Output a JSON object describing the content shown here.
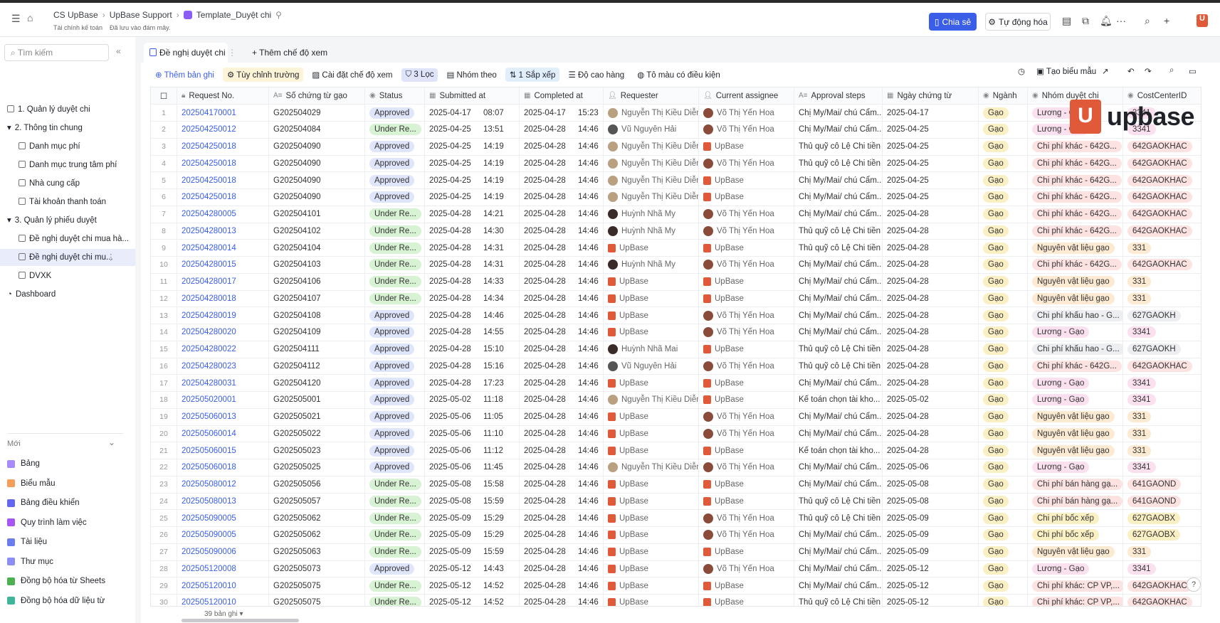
{
  "header": {
    "breadcrumb": [
      "CS UpBase",
      "UpBase Support",
      "Template_Duyệt chi"
    ],
    "workspace": "Tài chính kế toán",
    "save_status": "Đã lưu vào đám mây.",
    "share_label": "Chia sẻ",
    "automation_label": "Tự động hóa",
    "logo_text": "upbase"
  },
  "sidebar": {
    "search_placeholder": "Tìm kiếm",
    "items": [
      {
        "label": "1. Quản lý duyệt chi",
        "level": 0
      },
      {
        "label": "2. Thông tin chung",
        "level": 0,
        "expanded": true
      },
      {
        "label": "Danh mục phí",
        "level": 1
      },
      {
        "label": "Danh mục trung tâm phí",
        "level": 1
      },
      {
        "label": "Nhà cung cấp",
        "level": 1
      },
      {
        "label": "Tài khoản thanh toán",
        "level": 1
      },
      {
        "label": "3. Quản lý phiếu duyệt",
        "level": 0,
        "expanded": true
      },
      {
        "label": "Đề nghị duyệt chi mua hà...",
        "level": 1
      },
      {
        "label": "Đề nghị duyệt chi mu...",
        "level": 1,
        "active": true
      },
      {
        "label": "DVXK",
        "level": 1
      },
      {
        "label": "Dashboard",
        "level": 0
      }
    ],
    "new_label": "Mới",
    "new_items": [
      {
        "label": "Bảng",
        "color": "#a78bfa"
      },
      {
        "label": "Biểu mẫu",
        "color": "#f59e5b"
      },
      {
        "label": "Bảng điều khiển",
        "color": "#6366f1"
      },
      {
        "label": "Quy trình làm việc",
        "color": "#a855f7"
      },
      {
        "label": "Tài liệu",
        "color": "#6b7cf0"
      },
      {
        "label": "Thư mục",
        "color": "#8b8ef5"
      },
      {
        "label": "Đồng bộ hóa từ Sheets",
        "color": "#4caf50"
      },
      {
        "label": "Đồng bộ hóa dữ liệu từ",
        "color": "#3fb59a"
      }
    ]
  },
  "tabs": {
    "active": "Đề nghị duyệt chi",
    "add_view": "Thêm chế độ xem"
  },
  "toolbar": {
    "add_record": "Thêm bản ghi",
    "customize_fields": "Tùy chỉnh trường",
    "view_settings": "Cài đặt chế độ xem",
    "filter": "3 Lọc",
    "group": "Nhóm theo",
    "sort": "1 Sắp xếp",
    "row_height": "Độ cao hàng",
    "conditional_color": "Tô màu có điều kiện",
    "create_form": "Tạo biểu mẫu"
  },
  "columns": [
    "Request No.",
    "Số chứng từ gạo",
    "Status",
    "Submitted at",
    "Completed at",
    "Requester",
    "Current assignee",
    "Approval steps",
    "Ngày chứng từ",
    "Ngành",
    "Nhóm duyệt chi",
    "CostCenterID"
  ],
  "tag_colors": {
    "Lương - Gạo": "#fbe1ef",
    "Chi phí khác - 642G...": "#fde2e2",
    "Nguyên vật liệu gạo": "#fdead2",
    "Chi phí khấu hao - G...": "#eceef1",
    "Chi phí bán hàng gạ...": "#fde2e2",
    "Chi phí bốc xếp": "#fbefc4",
    "Chi phí khác: CP VP,...": "#fde2e2"
  },
  "rows": [
    {
      "n": "1",
      "id": "202504170001",
      "g": "G202504029",
      "s": "Approved",
      "sd": "2025-04-17",
      "st": "08:07",
      "cd": "2025-04-17",
      "ct": "15:23",
      "req": "Nguyễn Thị Kiều Diễm",
      "asg": "Võ Thị Yến Hoa",
      "step": "Chị My/Mai/ chú Cẩm...",
      "date": "2025-04-17",
      "ind": "Gạo",
      "grp": "Lương - Gạo",
      "cc": "3341"
    },
    {
      "n": "2",
      "id": "202504250012",
      "g": "G202504084",
      "s": "Under Re...",
      "sd": "2025-04-25",
      "st": "13:51",
      "cd": "2025-04-28",
      "ct": "14:46",
      "req": "Vũ Nguyên Hải",
      "asg": "Võ Thị Yến Hoa",
      "step": "Chị My/Mai/ chú Cẩm...",
      "date": "2025-04-25",
      "ind": "Gạo",
      "grp": "Lương - Gạo",
      "cc": "3341"
    },
    {
      "n": "3",
      "id": "202504250018",
      "g": "G202504090",
      "s": "Approved",
      "sd": "2025-04-25",
      "st": "14:19",
      "cd": "2025-04-28",
      "ct": "14:46",
      "req": "Nguyễn Thị Kiều Diễm",
      "asg": "UpBase",
      "step": "Thủ quỹ cô Lệ Chi tiền",
      "date": "2025-04-25",
      "ind": "Gạo",
      "grp": "Chi phí khác - 642G...",
      "cc": "642GAOKHAC"
    },
    {
      "n": "4",
      "id": "202504250018",
      "g": "G202504090",
      "s": "Approved",
      "sd": "2025-04-25",
      "st": "14:19",
      "cd": "2025-04-28",
      "ct": "14:46",
      "req": "Nguyễn Thị Kiều Diễm",
      "asg": "Võ Thị Yến Hoa",
      "step": "Thủ quỹ cô Lệ Chi tiền",
      "date": "2025-04-25",
      "ind": "Gạo",
      "grp": "Chi phí khác - 642G...",
      "cc": "642GAOKHAC"
    },
    {
      "n": "5",
      "id": "202504250018",
      "g": "G202504090",
      "s": "Approved",
      "sd": "2025-04-25",
      "st": "14:19",
      "cd": "2025-04-28",
      "ct": "14:46",
      "req": "Nguyễn Thị Kiều Diễm",
      "asg": "UpBase",
      "step": "Chị My/Mai/ chú Cẩm...",
      "date": "2025-04-25",
      "ind": "Gạo",
      "grp": "Chi phí khác - 642G...",
      "cc": "642GAOKHAC"
    },
    {
      "n": "6",
      "id": "202504250018",
      "g": "G202504090",
      "s": "Approved",
      "sd": "2025-04-25",
      "st": "14:19",
      "cd": "2025-04-28",
      "ct": "14:46",
      "req": "Nguyễn Thị Kiều Diễm",
      "asg": "UpBase",
      "step": "Chị My/Mai/ chú Cẩm...",
      "date": "2025-04-25",
      "ind": "Gạo",
      "grp": "Chi phí khác - 642G...",
      "cc": "642GAOKHAC"
    },
    {
      "n": "7",
      "id": "202504280005",
      "g": "G202504101",
      "s": "Under Re...",
      "sd": "2025-04-28",
      "st": "14:21",
      "cd": "2025-04-28",
      "ct": "14:46",
      "req": "Huỳnh Nhã My",
      "asg": "Võ Thị Yến Hoa",
      "step": "Chị My/Mai/ chú Cẩm...",
      "date": "2025-04-28",
      "ind": "Gạo",
      "grp": "Chi phí khác - 642G...",
      "cc": "642GAOKHAC"
    },
    {
      "n": "8",
      "id": "202504280013",
      "g": "G202504102",
      "s": "Under Re...",
      "sd": "2025-04-28",
      "st": "14:30",
      "cd": "2025-04-28",
      "ct": "14:46",
      "req": "Huỳnh Nhã My",
      "asg": "Võ Thị Yến Hoa",
      "step": "Thủ quỹ cô Lệ Chi tiền",
      "date": "2025-04-28",
      "ind": "Gạo",
      "grp": "Chi phí khác - 642G...",
      "cc": "642GAOKHAC"
    },
    {
      "n": "9",
      "id": "202504280014",
      "g": "G202504104",
      "s": "Under Re...",
      "sd": "2025-04-28",
      "st": "14:31",
      "cd": "2025-04-28",
      "ct": "14:46",
      "req": "UpBase",
      "asg": "UpBase",
      "step": "Thủ quỹ cô Lệ Chi tiền",
      "date": "2025-04-28",
      "ind": "Gạo",
      "grp": "Nguyên vật liệu gạo",
      "cc": "331"
    },
    {
      "n": "10",
      "id": "202504280015",
      "g": "G202504103",
      "s": "Under Re...",
      "sd": "2025-04-28",
      "st": "14:31",
      "cd": "2025-04-28",
      "ct": "14:46",
      "req": "Huỳnh Nhã My",
      "asg": "Võ Thị Yến Hoa",
      "step": "Chị My/Mai/ chú Cẩm...",
      "date": "2025-04-28",
      "ind": "Gạo",
      "grp": "Chi phí khác - 642G...",
      "cc": "642GAOKHAC"
    },
    {
      "n": "11",
      "id": "202504280017",
      "g": "G202504106",
      "s": "Under Re...",
      "sd": "2025-04-28",
      "st": "14:33",
      "cd": "2025-04-28",
      "ct": "14:46",
      "req": "UpBase",
      "asg": "UpBase",
      "step": "Chị My/Mai/ chú Cẩm...",
      "date": "2025-04-28",
      "ind": "Gạo",
      "grp": "Nguyên vật liệu gạo",
      "cc": "331"
    },
    {
      "n": "12",
      "id": "202504280018",
      "g": "G202504107",
      "s": "Under Re...",
      "sd": "2025-04-28",
      "st": "14:34",
      "cd": "2025-04-28",
      "ct": "14:46",
      "req": "UpBase",
      "asg": "UpBase",
      "step": "Chị My/Mai/ chú Cẩm...",
      "date": "2025-04-28",
      "ind": "Gạo",
      "grp": "Nguyên vật liệu gạo",
      "cc": "331"
    },
    {
      "n": "13",
      "id": "202504280019",
      "g": "G202504108",
      "s": "Approved",
      "sd": "2025-04-28",
      "st": "14:46",
      "cd": "2025-04-28",
      "ct": "14:46",
      "req": "UpBase",
      "asg": "Võ Thị Yến Hoa",
      "step": "Chị My/Mai/ chú Cẩm...",
      "date": "2025-04-28",
      "ind": "Gạo",
      "grp": "Chi phí khấu hao - G...",
      "cc": "627GAOKH"
    },
    {
      "n": "14",
      "id": "202504280020",
      "g": "G202504109",
      "s": "Approved",
      "sd": "2025-04-28",
      "st": "14:55",
      "cd": "2025-04-28",
      "ct": "14:46",
      "req": "UpBase",
      "asg": "Võ Thị Yến Hoa",
      "step": "Chị My/Mai/ chú Cẩm...",
      "date": "2025-04-28",
      "ind": "Gạo",
      "grp": "Lương - Gạo",
      "cc": "3341"
    },
    {
      "n": "15",
      "id": "202504280022",
      "g": "G202504111",
      "s": "Approved",
      "sd": "2025-04-28",
      "st": "15:10",
      "cd": "2025-04-28",
      "ct": "14:46",
      "req": "Huỳnh Nhã Mai",
      "asg": "UpBase",
      "step": "Thủ quỹ cô Lệ Chi tiền",
      "date": "2025-04-28",
      "ind": "Gạo",
      "grp": "Chi phí khấu hao - G...",
      "cc": "627GAOKH"
    },
    {
      "n": "16",
      "id": "202504280023",
      "g": "G202504112",
      "s": "Approved",
      "sd": "2025-04-28",
      "st": "15:16",
      "cd": "2025-04-28",
      "ct": "14:46",
      "req": "Vũ Nguyên Hải",
      "asg": "Võ Thị Yến Hoa",
      "step": "Thủ quỹ cô Lệ Chi tiền",
      "date": "2025-04-28",
      "ind": "Gạo",
      "grp": "Chi phí khác - 642G...",
      "cc": "642GAOKHAC"
    },
    {
      "n": "17",
      "id": "202504280031",
      "g": "G202504120",
      "s": "Approved",
      "sd": "2025-04-28",
      "st": "17:23",
      "cd": "2025-04-28",
      "ct": "14:46",
      "req": "UpBase",
      "asg": "UpBase",
      "step": "Chị My/Mai/ chú Cẩm...",
      "date": "2025-04-28",
      "ind": "Gạo",
      "grp": "Lương - Gạo",
      "cc": "3341"
    },
    {
      "n": "18",
      "id": "202505020001",
      "g": "G202505001",
      "s": "Approved",
      "sd": "2025-05-02",
      "st": "11:18",
      "cd": "2025-04-28",
      "ct": "14:46",
      "req": "Nguyễn Thị Kiều Diễm",
      "asg": "UpBase",
      "step": "Kế toán chọn tài kho...",
      "date": "2025-05-02",
      "ind": "Gạo",
      "grp": "Lương - Gạo",
      "cc": "3341"
    },
    {
      "n": "19",
      "id": "202505060013",
      "g": "G202505021",
      "s": "Approved",
      "sd": "2025-05-06",
      "st": "11:05",
      "cd": "2025-04-28",
      "ct": "14:46",
      "req": "UpBase",
      "asg": "Võ Thị Yến Hoa",
      "step": "Chị My/Mai/ chú Cẩm...",
      "date": "2025-04-28",
      "ind": "Gạo",
      "grp": "Nguyên vật liệu gạo",
      "cc": "331"
    },
    {
      "n": "20",
      "id": "202505060014",
      "g": "G202505022",
      "s": "Approved",
      "sd": "2025-05-06",
      "st": "11:10",
      "cd": "2025-04-28",
      "ct": "14:46",
      "req": "UpBase",
      "asg": "Võ Thị Yến Hoa",
      "step": "Chị My/Mai/ chú Cẩm...",
      "date": "2025-04-28",
      "ind": "Gạo",
      "grp": "Nguyên vật liệu gạo",
      "cc": "331"
    },
    {
      "n": "21",
      "id": "202505060015",
      "g": "G202505023",
      "s": "Approved",
      "sd": "2025-05-06",
      "st": "11:12",
      "cd": "2025-04-28",
      "ct": "14:46",
      "req": "UpBase",
      "asg": "UpBase",
      "step": "Kế toán chọn tài kho...",
      "date": "2025-04-28",
      "ind": "Gạo",
      "grp": "Nguyên vật liệu gạo",
      "cc": "331"
    },
    {
      "n": "22",
      "id": "202505060018",
      "g": "G202505025",
      "s": "Approved",
      "sd": "2025-05-06",
      "st": "11:45",
      "cd": "2025-04-28",
      "ct": "14:46",
      "req": "Nguyễn Thị Kiều Diễm",
      "asg": "Võ Thị Yến Hoa",
      "step": "Chị My/Mai/ chú Cẩm...",
      "date": "2025-05-06",
      "ind": "Gạo",
      "grp": "Lương - Gạo",
      "cc": "3341"
    },
    {
      "n": "23",
      "id": "202505080012",
      "g": "G202505056",
      "s": "Under Re...",
      "sd": "2025-05-08",
      "st": "15:58",
      "cd": "2025-04-28",
      "ct": "14:46",
      "req": "UpBase",
      "asg": "UpBase",
      "step": "Chị My/Mai/ chú Cẩm...",
      "date": "2025-05-08",
      "ind": "Gạo",
      "grp": "Chi phí bán hàng gạ...",
      "cc": "641GAOND"
    },
    {
      "n": "24",
      "id": "202505080013",
      "g": "G202505057",
      "s": "Under Re...",
      "sd": "2025-05-08",
      "st": "15:59",
      "cd": "2025-04-28",
      "ct": "14:46",
      "req": "UpBase",
      "asg": "UpBase",
      "step": "Thủ quỹ cô Lệ Chi tiền",
      "date": "2025-05-08",
      "ind": "Gạo",
      "grp": "Chi phí bán hàng gạ...",
      "cc": "641GAOND"
    },
    {
      "n": "25",
      "id": "202505090005",
      "g": "G202505062",
      "s": "Under Re...",
      "sd": "2025-05-09",
      "st": "15:29",
      "cd": "2025-04-28",
      "ct": "14:46",
      "req": "UpBase",
      "asg": "Võ Thị Yến Hoa",
      "step": "Thủ quỹ cô Lệ Chi tiền",
      "date": "2025-05-09",
      "ind": "Gạo",
      "grp": "Chi phí bốc xếp",
      "cc": "627GAOBX"
    },
    {
      "n": "26",
      "id": "202505090005",
      "g": "G202505062",
      "s": "Under Re...",
      "sd": "2025-05-09",
      "st": "15:29",
      "cd": "2025-04-28",
      "ct": "14:46",
      "req": "UpBase",
      "asg": "Võ Thị Yến Hoa",
      "step": "Chị My/Mai/ chú Cẩm...",
      "date": "2025-05-09",
      "ind": "Gạo",
      "grp": "Chi phí bốc xếp",
      "cc": "627GAOBX"
    },
    {
      "n": "27",
      "id": "202505090006",
      "g": "G202505063",
      "s": "Under Re...",
      "sd": "2025-05-09",
      "st": "15:59",
      "cd": "2025-04-28",
      "ct": "14:46",
      "req": "UpBase",
      "asg": "UpBase",
      "step": "Chị My/Mai/ chú Cẩm...",
      "date": "2025-05-09",
      "ind": "Gạo",
      "grp": "Nguyên vật liệu gạo",
      "cc": "331"
    },
    {
      "n": "28",
      "id": "202505120008",
      "g": "G202505073",
      "s": "Approved",
      "sd": "2025-05-12",
      "st": "14:43",
      "cd": "2025-04-28",
      "ct": "14:46",
      "req": "UpBase",
      "asg": "Võ Thị Yến Hoa",
      "step": "Chị My/Mai/ chú Cẩm...",
      "date": "2025-05-12",
      "ind": "Gạo",
      "grp": "Lương - Gạo",
      "cc": "3341"
    },
    {
      "n": "29",
      "id": "202505120010",
      "g": "G202505075",
      "s": "Under Re...",
      "sd": "2025-05-12",
      "st": "14:52",
      "cd": "2025-04-28",
      "ct": "14:46",
      "req": "UpBase",
      "asg": "UpBase",
      "step": "Chị My/Mai/ chú Cẩm...",
      "date": "2025-05-12",
      "ind": "Gạo",
      "grp": "Chi phí khác: CP VP,...",
      "cc": "642GAOKHAC"
    },
    {
      "n": "30",
      "id": "202505120010",
      "g": "G202505075",
      "s": "Under Re...",
      "sd": "2025-05-12",
      "st": "14:52",
      "cd": "2025-04-28",
      "ct": "14:46",
      "req": "UpBase",
      "asg": "UpBase",
      "step": "Thủ quỹ cô Lệ Chi tiền",
      "date": "2025-05-12",
      "ind": "Gạo",
      "grp": "Chi phí khác: CP VP,...",
      "cc": "642GAOKHAC"
    }
  ],
  "footer": {
    "record_count": "39 bản ghi"
  }
}
